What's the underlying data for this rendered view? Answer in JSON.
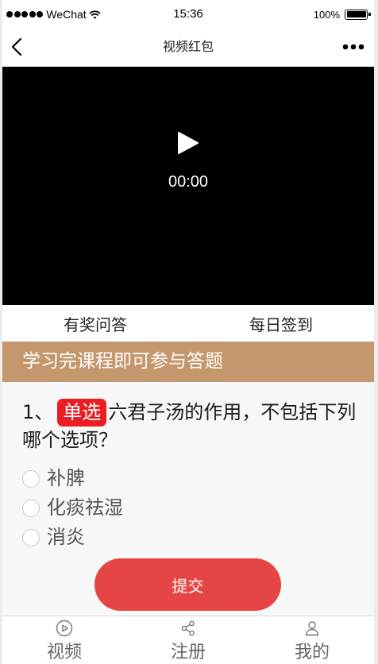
{
  "status_bar": {
    "signal_level": 5,
    "signal_icon": "signal-dots-icon",
    "carrier": "WeChat",
    "wifi_icon": "wifi-icon",
    "time": "15:36",
    "battery_text": "100%",
    "battery_level": 1.0,
    "battery_icon": "battery-icon"
  },
  "nav": {
    "title": "视频红包",
    "back_icon": "chevron-left-icon",
    "more_icon": "more-dots-icon"
  },
  "video": {
    "current_time": "00:00",
    "play_icon": "play-icon"
  },
  "tabs": [
    {
      "label": "有奖问答"
    },
    {
      "label": "每日签到"
    }
  ],
  "banner": {
    "text": "学习完课程即可参与答题"
  },
  "question": {
    "number": "1、",
    "type_badge": "单选",
    "text": "六君子汤的作用，不包括下列哪个选项？",
    "options": [
      {
        "label": "补脾",
        "selected": false
      },
      {
        "label": "化痰祛湿",
        "selected": false
      },
      {
        "label": "消炎",
        "selected": false
      }
    ]
  },
  "submit": {
    "label": "提交"
  },
  "tabbar": [
    {
      "label": "视频",
      "icon": "play-circle-icon"
    },
    {
      "label": "注册",
      "icon": "share-icon"
    },
    {
      "label": "我的",
      "icon": "user-icon"
    }
  ],
  "colors": {
    "banner_bg": "#c4976c",
    "badge_bg": "#ec1c24",
    "submit_bg": "#e64545",
    "question_bg": "#f7f7f7"
  }
}
